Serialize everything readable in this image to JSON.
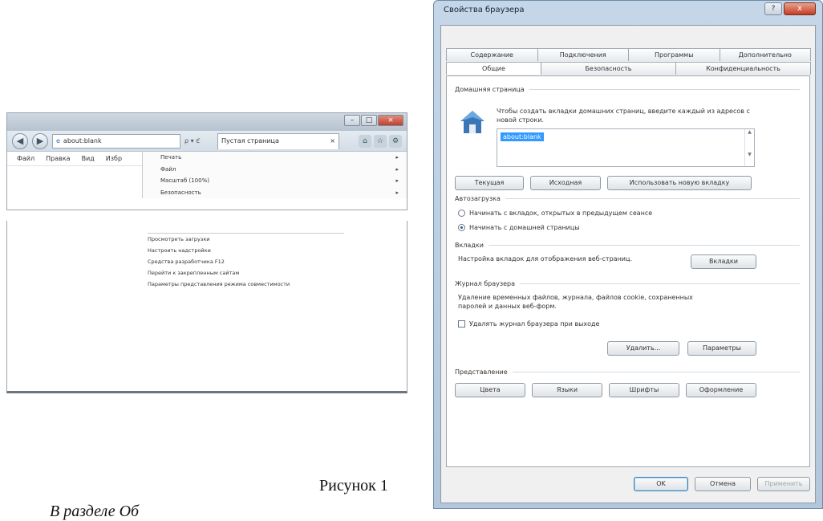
{
  "browser": {
    "address_text": "about:blank",
    "address_controls": "ρ ▾ ℭ",
    "tab_label": "Пустая страница",
    "tab_close": "×",
    "menubar": [
      "Файл",
      "Правка",
      "Вид",
      "Избр"
    ],
    "dropdown_items": [
      {
        "label": "Печать",
        "arrow": "▸"
      },
      {
        "label": "Файл",
        "arrow": "▸"
      },
      {
        "label": "Масштаб (100%)",
        "arrow": "▸"
      },
      {
        "label": "Безопасность",
        "arrow": "▸"
      }
    ],
    "continued_items": [
      "Просмотреть загрузки",
      "Настроить надстройки",
      "Средства разработчика F12",
      "Перейти к закрепленным сайтам",
      "Параметры представления режима совместимости"
    ]
  },
  "caption": "Рисунок 1",
  "bottom_text": "В разделе Об",
  "dialog": {
    "title": "Свойства браузера",
    "close": "x",
    "help": "?",
    "tabs_row1": [
      "Содержание",
      "Подключения",
      "Программы",
      "Дополнительно"
    ],
    "tabs_row2": [
      "Общие",
      "Безопасность",
      "Конфиденциальность"
    ],
    "home": {
      "group": "Домашняя страница",
      "desc": "Чтобы создать вкладки домашних страниц, введите каждый из адресов с новой строки.",
      "value": "about:blank",
      "btn_current": "Текущая",
      "btn_default": "Исходная",
      "btn_newtab": "Использовать новую вкладку"
    },
    "startup": {
      "group": "Автозагрузка",
      "opt1": "Начинать с вкладок, открытых в предыдущем сеансе",
      "opt2": "Начинать с домашней страницы",
      "selected": 2
    },
    "tabs": {
      "group": "Вкладки",
      "desc": "Настройка вкладок для отображения веб-страниц.",
      "button": "Вкладки"
    },
    "history": {
      "group": "Журнал браузера",
      "desc": "Удаление временных файлов, журнала, файлов cookie, сохраненных паролей и данных веб-форм.",
      "checkbox": "Удалять журнал браузера при выходе",
      "btn_delete": "Удалить...",
      "btn_params": "Параметры"
    },
    "appearance": {
      "group": "Представление",
      "btn_colors": "Цвета",
      "btn_langs": "Языки",
      "btn_fonts": "Шрифты",
      "btn_access": "Оформление"
    },
    "footer": {
      "ok": "OK",
      "cancel": "Отмена",
      "apply": "Применить"
    }
  }
}
